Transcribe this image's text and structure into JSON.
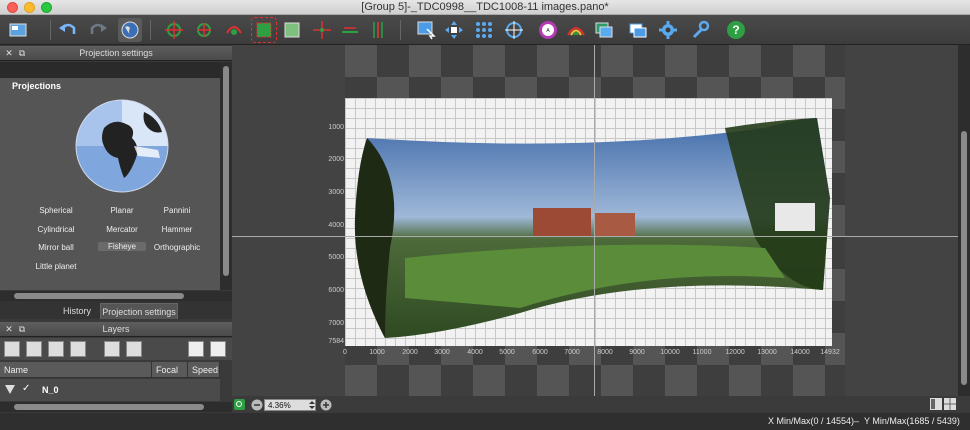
{
  "window": {
    "title": "[Group 5]-_TDC0998__TDC1008-11 images.pano*"
  },
  "projection_panel": {
    "header": "Projection settings",
    "section_label": "Projections",
    "items": [
      {
        "label": "Spherical",
        "selected": false
      },
      {
        "label": "Planar",
        "selected": false
      },
      {
        "label": "Pannini",
        "selected": false
      },
      {
        "label": "Cylindrical",
        "selected": false
      },
      {
        "label": "Mercator",
        "selected": false
      },
      {
        "label": "Hammer",
        "selected": false
      },
      {
        "label": "Mirror ball",
        "selected": false
      },
      {
        "label": "Fisheye",
        "selected": true
      },
      {
        "label": "Orthographic",
        "selected": false
      },
      {
        "label": "Little planet",
        "selected": false
      }
    ]
  },
  "tabs": [
    {
      "label": "History",
      "active": false
    },
    {
      "label": "Projection settings",
      "active": true
    }
  ],
  "layers_panel": {
    "header": "Layers",
    "columns": [
      "Name",
      "Focal",
      "Speed"
    ],
    "rows": [
      {
        "name": "N_0",
        "checked": true
      }
    ]
  },
  "canvas": {
    "y_ticks": [
      "1000",
      "2000",
      "3000",
      "4000",
      "5000",
      "6000",
      "7000",
      "7584"
    ],
    "x_ticks": [
      "0",
      "1000",
      "2000",
      "3000",
      "4000",
      "5000",
      "6000",
      "7000",
      "8000",
      "9000",
      "10000",
      "11000",
      "12000",
      "13000",
      "14000",
      "14932"
    ]
  },
  "zoom": {
    "value": "4.36%"
  },
  "status": {
    "x_minmax": "X Min/Max(0 / 14554)",
    "separator": "–",
    "y_minmax": "Y Min/Max(1685 / 5439)"
  },
  "colors": {
    "accent_green": "#2ea043",
    "selection_red": "#e03030",
    "checker_dark": "#3e3e3e"
  }
}
